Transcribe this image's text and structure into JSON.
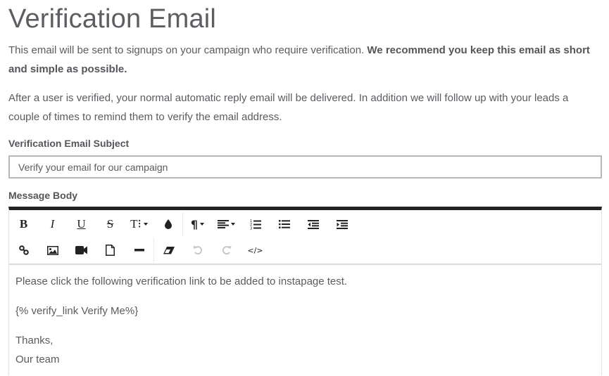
{
  "page": {
    "title": "Verification Email",
    "intro": {
      "text": "This email will be sent to signups on your campaign who require verification. ",
      "emphasis": "We recommend you keep this email as short and simple as possible."
    },
    "followup": "After a user is verified, your normal automatic reply email will be delivered. In addition we will follow up with your leads a couple of times to remind them to verify the email address."
  },
  "form": {
    "subject_label": "Verification Email Subject",
    "subject_value": "Verify your email for our campaign",
    "body_label": "Message Body"
  },
  "toolbar": {
    "row1": [
      {
        "name": "bold-button",
        "icon": "bold-icon",
        "glyph": "B"
      },
      {
        "name": "italic-button",
        "icon": "italic-icon",
        "glyph": "I"
      },
      {
        "name": "underline-button",
        "icon": "underline-icon",
        "glyph": "U"
      },
      {
        "name": "strikethrough-button",
        "icon": "strikethrough-icon",
        "glyph": "S"
      },
      {
        "name": "font-size-dropdown",
        "icon": "text-height-icon",
        "glyph": "T⁝"
      },
      {
        "name": "color-button",
        "icon": "color-drop-icon"
      },
      {
        "name": "paragraph-format-dropdown",
        "icon": "paragraph-icon",
        "glyph": "¶"
      },
      {
        "name": "align-dropdown",
        "icon": "align-left-icon"
      },
      {
        "name": "ordered-list-button",
        "icon": "ordered-list-icon"
      },
      {
        "name": "unordered-list-button",
        "icon": "unordered-list-icon"
      },
      {
        "name": "outdent-button",
        "icon": "outdent-icon"
      },
      {
        "name": "indent-button",
        "icon": "indent-icon"
      }
    ],
    "row2": [
      {
        "name": "insert-link-button",
        "icon": "link-icon"
      },
      {
        "name": "insert-image-button",
        "icon": "image-icon"
      },
      {
        "name": "insert-video-button",
        "icon": "video-icon"
      },
      {
        "name": "insert-file-button",
        "icon": "file-icon"
      },
      {
        "name": "insert-hr-button",
        "icon": "horizontal-rule-icon"
      },
      {
        "name": "clear-format-button",
        "icon": "eraser-icon"
      },
      {
        "name": "undo-button",
        "icon": "undo-icon",
        "disabled": true
      },
      {
        "name": "redo-button",
        "icon": "redo-icon",
        "disabled": true
      },
      {
        "name": "code-view-button",
        "icon": "code-icon",
        "glyph": "</>"
      }
    ]
  },
  "message_body": {
    "lines": [
      "Please click the following verification link to be added to instapage test.",
      "{% verify_link Verify Me%}",
      "Thanks,",
      "Our team"
    ]
  },
  "colors": {
    "text": "#5b5b60",
    "editor_top_border": "#222222",
    "input_border": "#b7b7b7"
  }
}
